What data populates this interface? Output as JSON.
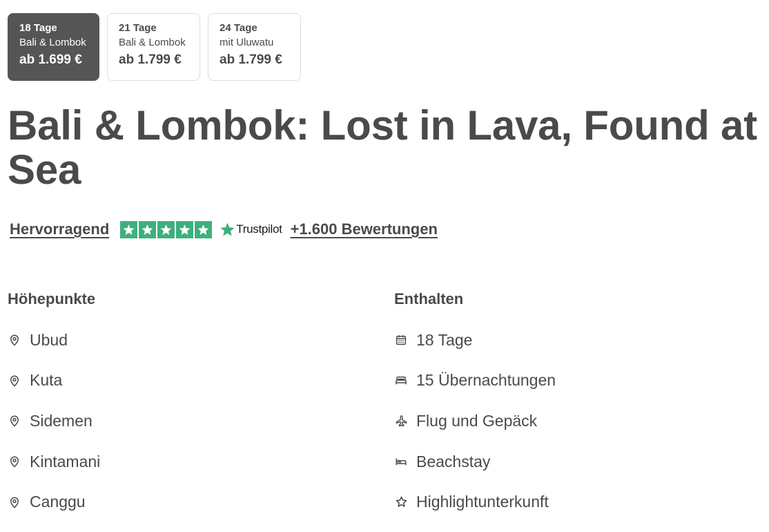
{
  "tabs": [
    {
      "days": "18 Tage",
      "route": "Bali & Lombok",
      "price": "ab 1.699 €",
      "active": true
    },
    {
      "days": "21 Tage",
      "route": "Bali & Lombok",
      "price": "ab 1.799 €",
      "active": false
    },
    {
      "days": "24 Tage",
      "route": "mit Uluwatu",
      "price": "ab 1.799 €",
      "active": false
    }
  ],
  "title": "Bali & Lombok: Lost in Lava, Found at Sea",
  "rating": {
    "label": "Hervorragend",
    "stars": 5,
    "provider": "Trustpilot",
    "reviews": "+1.600 Bewertungen",
    "star_color": "#3eb07c"
  },
  "highlights": {
    "heading": "Höhepunkte",
    "items": [
      {
        "label": "Ubud",
        "icon": "map-pin-icon"
      },
      {
        "label": "Kuta",
        "icon": "map-pin-icon"
      },
      {
        "label": "Sidemen",
        "icon": "map-pin-icon"
      },
      {
        "label": "Kintamani",
        "icon": "map-pin-icon"
      },
      {
        "label": "Canggu",
        "icon": "map-pin-icon"
      }
    ]
  },
  "included": {
    "heading": "Enthalten",
    "items": [
      {
        "label": "18 Tage",
        "icon": "calendar-icon"
      },
      {
        "label": "15 Übernachtungen",
        "icon": "bed-icon"
      },
      {
        "label": "Flug und Gepäck",
        "icon": "plane-icon"
      },
      {
        "label": "Beachstay",
        "icon": "beach-bed-icon"
      },
      {
        "label": "Highlightunterkunft",
        "icon": "star-outline-icon"
      }
    ]
  },
  "colors": {
    "text": "#4a4a4a",
    "active_tab": "#555555"
  }
}
